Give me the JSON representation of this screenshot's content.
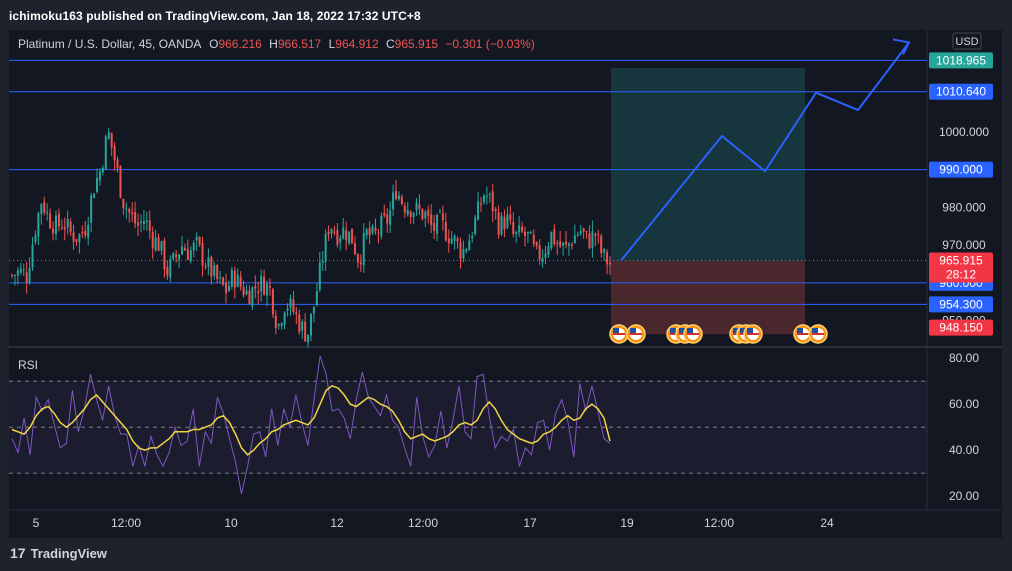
{
  "header": {
    "text": "ichimoku163 published on TradingView.com, Jan 18, 2022 17:32 UTC+8"
  },
  "legend": {
    "symbol": "Platinum / U.S. Dollar, 45, OANDA",
    "o_label": "O",
    "o_value": "966.216",
    "h_label": "H",
    "h_value": "966.517",
    "l_label": "L",
    "l_value": "964.912",
    "c_label": "C",
    "c_value": "965.915",
    "change": "−0.301 (−0.03%)"
  },
  "currency_button": "USD",
  "rsi_label": "RSI",
  "footer": {
    "brand": "TradingView",
    "logo_glyph": "17"
  },
  "colors": {
    "up": "#26a69a",
    "down": "#ef5350",
    "line": "#2962ff",
    "rsi": "#7e57c2",
    "rsi_ma": "#f2d544",
    "price_label": "#f23645"
  },
  "chart_data": [
    {
      "type": "candlestick",
      "title": "Platinum / U.S. Dollar, 45, OANDA",
      "ylim": [
        943,
        1027
      ],
      "x_ticks": [
        "5",
        "12:00",
        "10",
        "12",
        "12:00",
        "17",
        "19",
        "12:00",
        "24"
      ],
      "y_ticks": [
        "1000.000",
        "980.000",
        "970.000"
      ],
      "horizontal_levels": [
        "1018.965",
        "1010.640",
        "990.000",
        "960.000",
        "954.300",
        "948.150"
      ],
      "current_price": {
        "value": "965.915",
        "countdown": "28:12"
      },
      "close_path": [
        962,
        963,
        962,
        973,
        982,
        977,
        975,
        976,
        973,
        972,
        975,
        985,
        990,
        1000,
        992,
        982,
        978,
        975,
        977,
        972,
        970,
        963,
        966,
        970,
        968,
        970,
        966,
        963,
        960,
        958,
        962,
        959,
        957,
        959,
        960,
        958,
        948,
        955,
        953,
        949,
        946,
        955,
        966,
        976,
        973,
        974,
        972,
        966,
        973,
        972,
        975,
        977,
        985,
        981,
        980,
        979,
        978,
        974,
        976,
        973,
        971,
        968,
        972,
        978,
        984,
        981,
        975,
        977,
        972,
        973,
        972,
        967,
        968,
        973,
        970,
        969,
        972,
        974,
        971,
        973,
        967,
        965
      ],
      "projection": {
        "entry": 965.9,
        "target_zone": [
          965.9,
          1016.9
        ],
        "stop_zone": [
          946.4,
          965.9
        ],
        "path": [
          [
            0,
            965.9
          ],
          [
            1,
            998.9
          ],
          [
            2,
            989.6
          ],
          [
            3,
            1010.4
          ],
          [
            4,
            1005.8
          ],
          [
            5,
            1023.7
          ]
        ]
      },
      "event_flags": [
        "US",
        "US",
        "US",
        "US",
        "US",
        "US",
        "US",
        "US",
        "US",
        "US"
      ]
    },
    {
      "type": "line",
      "title": "RSI",
      "ylim": [
        14,
        84
      ],
      "y_ticks": [
        "80.00",
        "60.00",
        "40.00",
        "20.00"
      ],
      "bands": [
        70,
        50,
        30
      ],
      "series": [
        {
          "values": [
            45,
            39,
            54,
            38,
            63,
            57,
            62,
            51,
            41,
            43,
            66,
            48,
            58,
            73,
            62,
            53,
            68,
            55,
            47,
            47,
            33,
            42,
            33,
            46,
            38,
            33,
            39,
            50,
            42,
            44,
            58,
            33,
            48,
            43,
            63,
            56,
            45,
            35,
            21,
            33,
            47,
            48,
            37,
            58,
            42,
            58,
            50,
            64,
            52,
            42,
            62,
            81,
            73,
            57,
            58,
            54,
            45,
            62,
            74,
            63,
            59,
            55,
            64,
            53,
            50,
            41,
            33,
            63,
            46,
            37,
            42,
            57,
            41,
            53,
            68,
            48,
            45,
            72,
            73,
            55,
            41,
            46,
            44,
            49,
            33,
            41,
            38,
            52,
            53,
            40,
            56,
            62,
            53,
            37,
            69,
            57,
            68,
            57,
            45,
            43
          ]
        },
        {
          "values": [
            49,
            48,
            47,
            50,
            55,
            58,
            59,
            56,
            52,
            50,
            52,
            55,
            58,
            62,
            64,
            61,
            58,
            55,
            52,
            49,
            44,
            41,
            40,
            41,
            41,
            43,
            45,
            48,
            48,
            48,
            49,
            49,
            50,
            51,
            54,
            55,
            52,
            47,
            41,
            38,
            40,
            43,
            45,
            48,
            49,
            51,
            52,
            53,
            52,
            51,
            54,
            60,
            66,
            68,
            67,
            64,
            60,
            59,
            61,
            63,
            62,
            60,
            59,
            57,
            53,
            48,
            45,
            46,
            47,
            45,
            44,
            45,
            46,
            48,
            51,
            52,
            51,
            53,
            58,
            61,
            58,
            53,
            49,
            47,
            45,
            44,
            43,
            44,
            47,
            48,
            50,
            53,
            55,
            53,
            54,
            58,
            60,
            58,
            54,
            44
          ]
        }
      ]
    }
  ]
}
